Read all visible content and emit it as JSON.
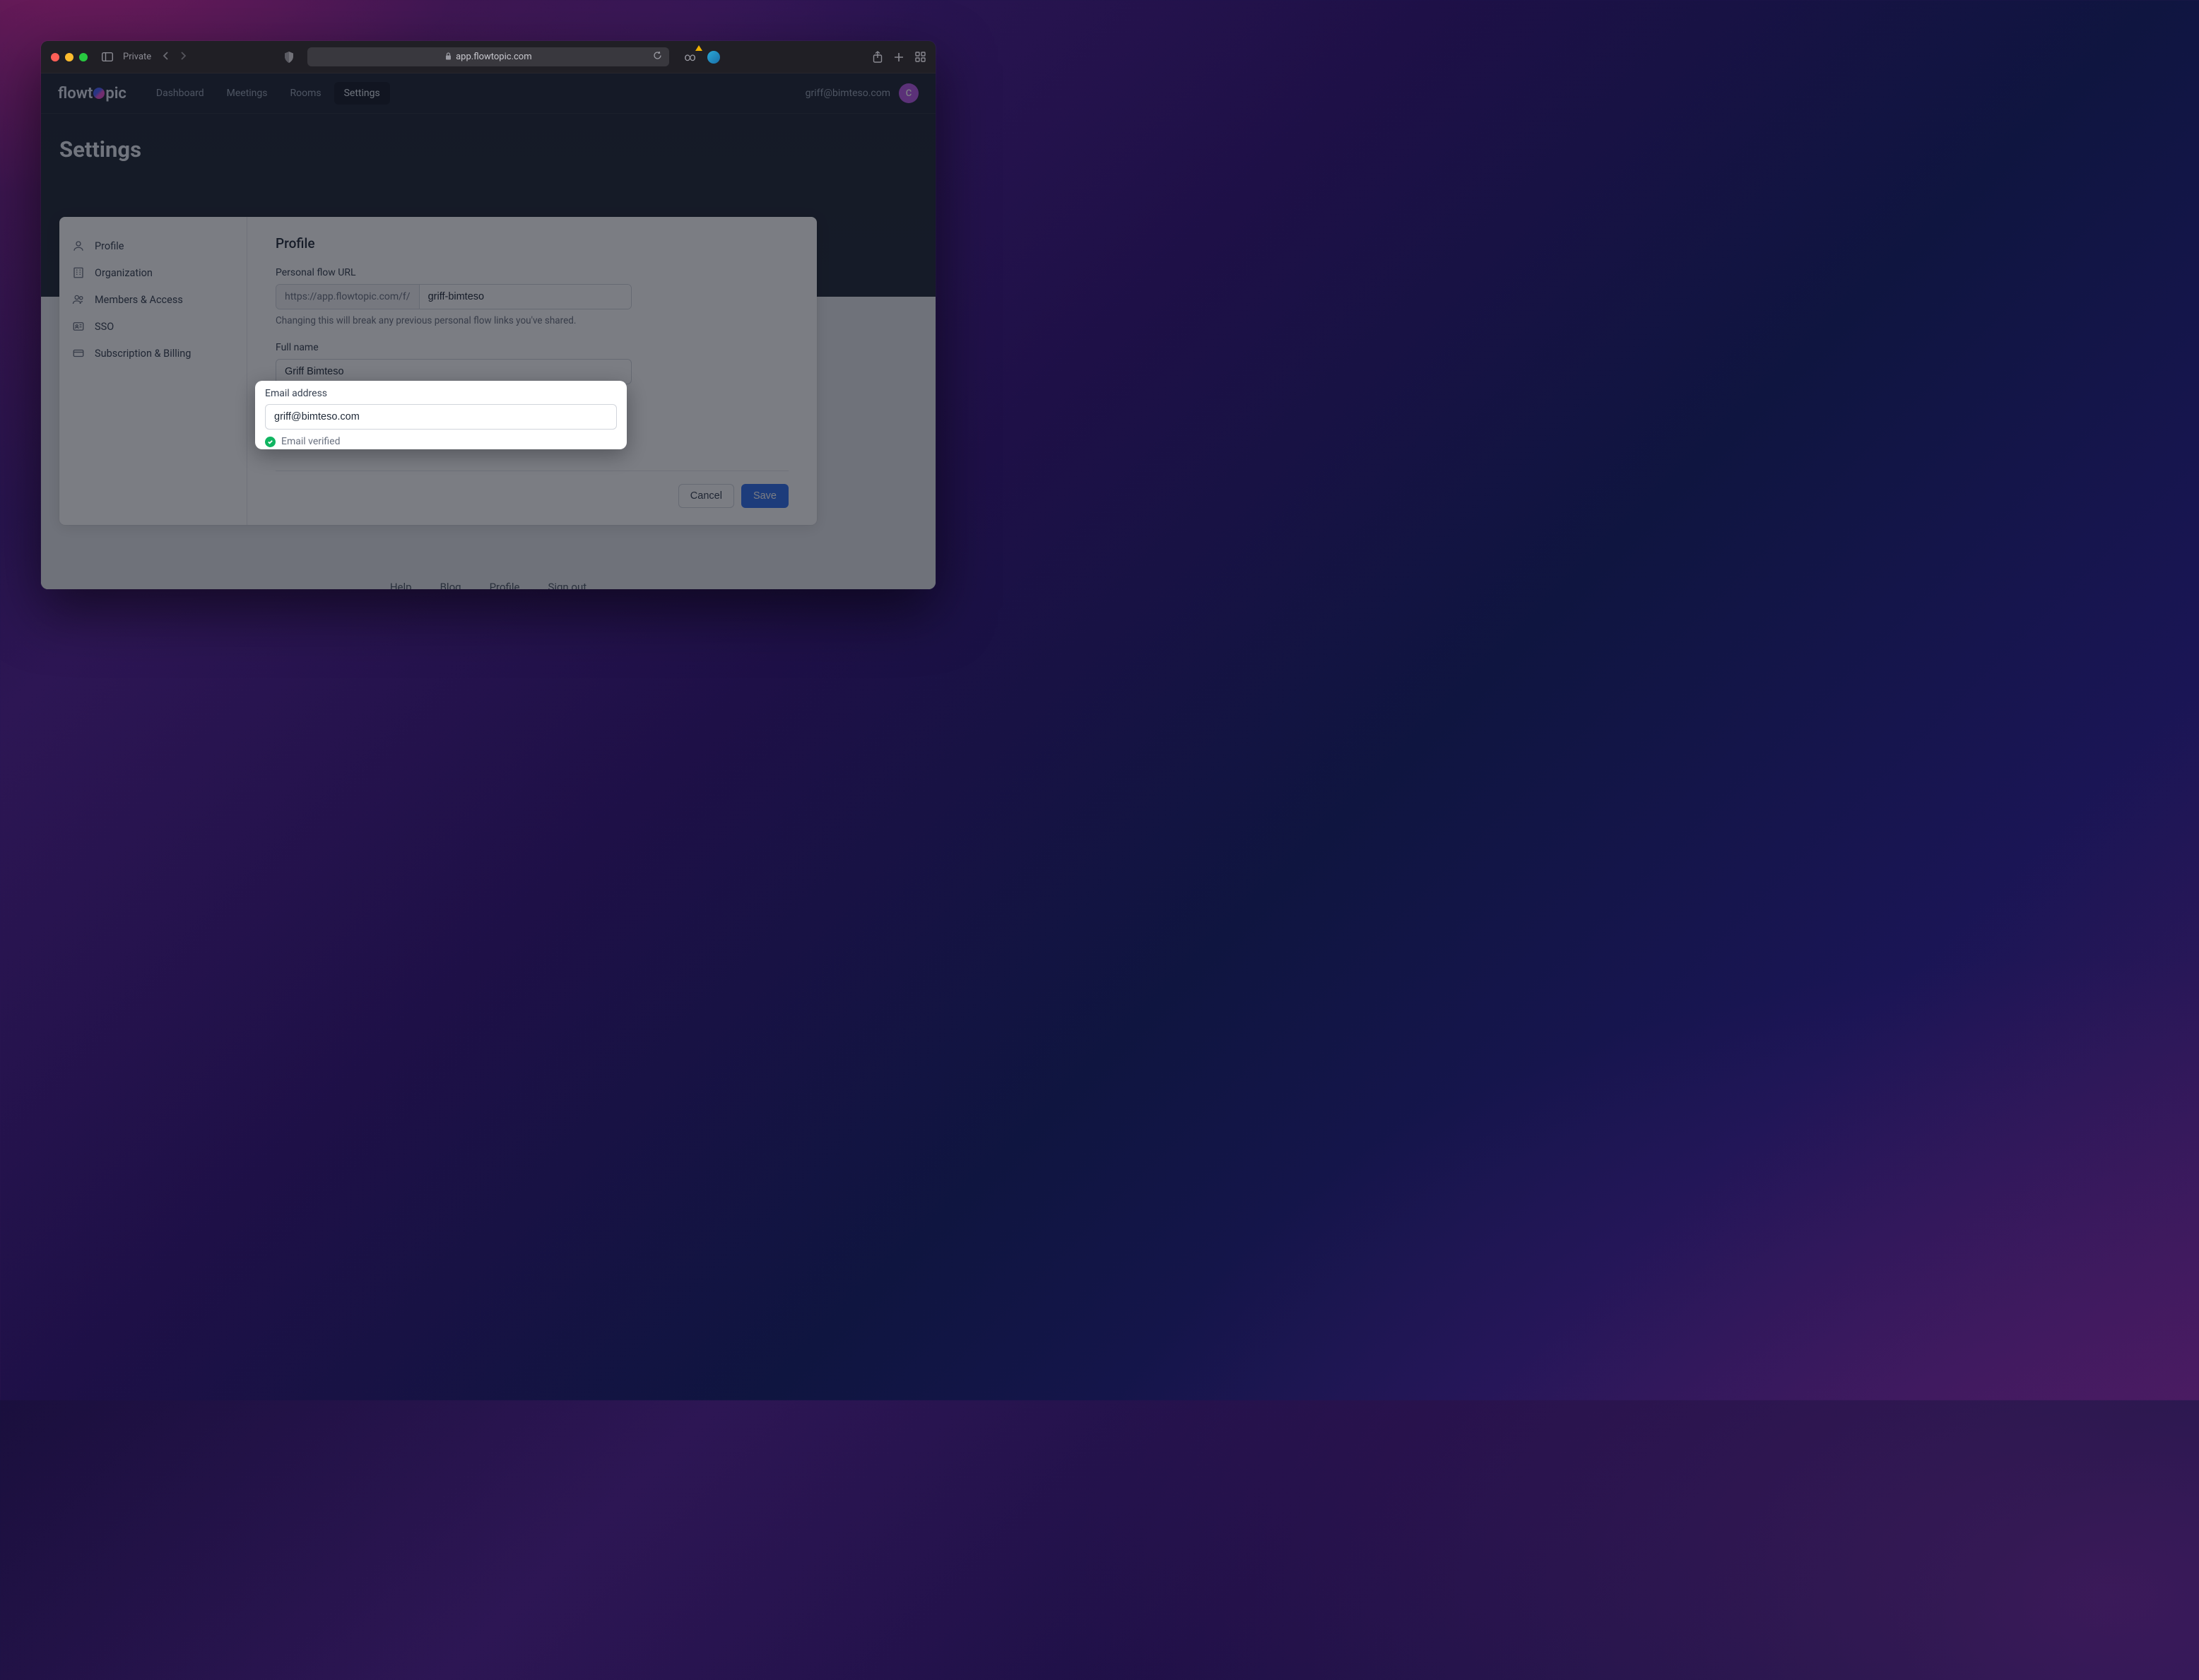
{
  "browser": {
    "private_label": "Private",
    "url_display": "app.flowtopic.com",
    "lock": "🔒"
  },
  "app": {
    "logo_pre": "flowt",
    "logo_post": "pic",
    "nav": [
      {
        "label": "Dashboard",
        "active": false
      },
      {
        "label": "Meetings",
        "active": false
      },
      {
        "label": "Rooms",
        "active": false
      },
      {
        "label": "Settings",
        "active": true
      }
    ],
    "user_email": "griff@bimteso.com",
    "avatar_initial": "C",
    "page_title": "Settings"
  },
  "sidebar": {
    "items": [
      {
        "label": "Profile"
      },
      {
        "label": "Organization"
      },
      {
        "label": "Members & Access"
      },
      {
        "label": "SSO"
      },
      {
        "label": "Subscription & Billing"
      }
    ]
  },
  "profile": {
    "heading": "Profile",
    "url_label": "Personal flow URL",
    "url_prefix": "https://app.flowtopic.com/f/",
    "url_value": "griff-bimteso",
    "url_helper": "Changing this will break any previous personal flow links you've shared.",
    "name_label": "Full name",
    "name_value": "Griff Bimteso",
    "email_label": "Email address",
    "email_value": "griff@bimteso.com",
    "email_verified_label": "Email verified",
    "cancel_label": "Cancel",
    "save_label": "Save"
  },
  "footer": {
    "links": [
      "Help",
      "Blog",
      "Profile",
      "Sign out"
    ]
  }
}
